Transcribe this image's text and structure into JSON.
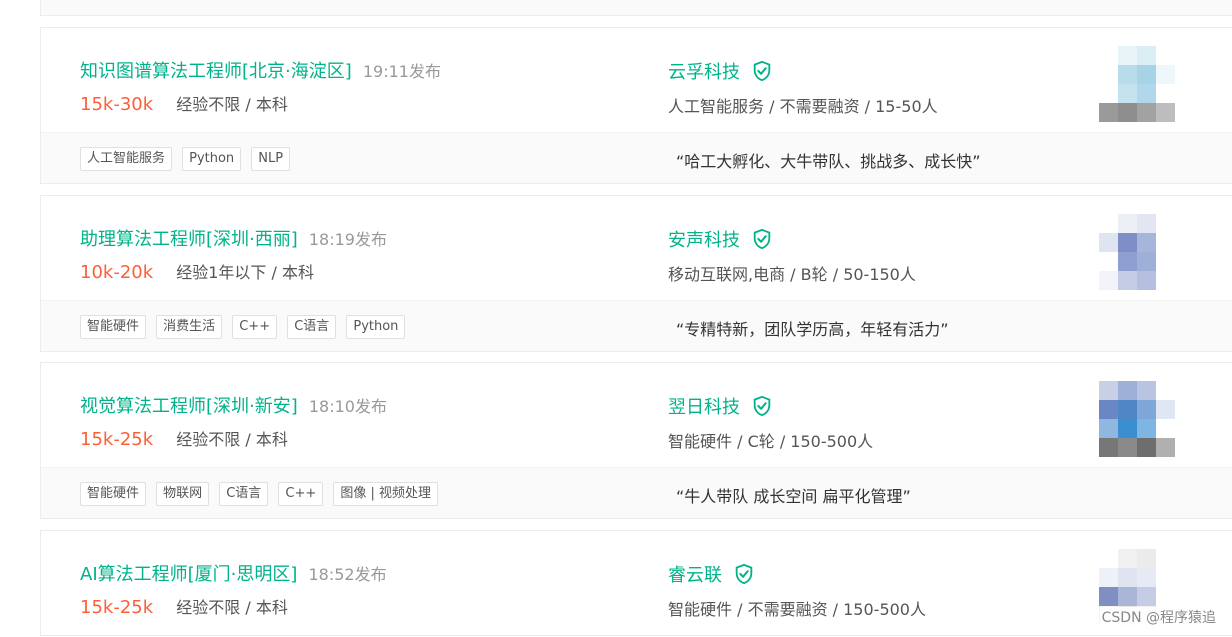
{
  "prev_card_tags": [
    "",
    "",
    "",
    ""
  ],
  "jobs": [
    {
      "title": "知识图谱算法工程师[北京·海淀区]",
      "time": "19:11发布",
      "salary": "15k-30k",
      "requirements": "经验不限 / 本科",
      "company": "云孚科技",
      "industry": "人工智能服务 / 不需要融资 / 15-50人",
      "tags": [
        "人工智能服务",
        "Python",
        "NLP"
      ],
      "slogan": "“哈工大孵化、大牛带队、挑战多、成长快”"
    },
    {
      "title": "助理算法工程师[深圳·西丽]",
      "time": "18:19发布",
      "salary": "10k-20k",
      "requirements": "经验1年以下 / 本科",
      "company": "安声科技",
      "industry": "移动互联网,电商 / B轮 / 50-150人",
      "tags": [
        "智能硬件",
        "消费生活",
        "C++",
        "C语言",
        "Python"
      ],
      "slogan": "“专精特新，团队学历高，年轻有活力”"
    },
    {
      "title": "视觉算法工程师[深圳·新安]",
      "time": "18:10发布",
      "salary": "15k-25k",
      "requirements": "经验不限 / 本科",
      "company": "翌日科技",
      "industry": "智能硬件 / C轮 / 150-500人",
      "tags": [
        "智能硬件",
        "物联网",
        "C语言",
        "C++",
        "图像 | 视频处理"
      ],
      "slogan": "“牛人带队 成长空间 扁平化管理”"
    },
    {
      "title": "AI算法工程师[厦门·思明区]",
      "time": "18:52发布",
      "salary": "15k-25k",
      "requirements": "经验不限 / 本科",
      "company": "睿云联",
      "industry": "智能硬件 / 不需要融资 / 150-500人",
      "tags": [],
      "slogan": ""
    }
  ],
  "watermark": "CSDN @程序猿追",
  "colors": {
    "accent": "#00b38a",
    "salary": "#fd5f39",
    "logos": [
      [
        "#ffffff",
        "#e8f3f8",
        "#d9eef5",
        "#ffffff",
        "#ffffff",
        "#b8dcea",
        "#a6d3e6",
        "#eef7fb",
        "#ffffff",
        "#c5e3ef",
        "#b0d8ea",
        "#ffffff",
        "#9a9a9a",
        "#8e8e8e",
        "#a2a2a2",
        "#bdbdbd"
      ],
      [
        "#ffffff",
        "#eceff6",
        "#e1e6f2",
        "#ffffff",
        "#dfe4f1",
        "#7d8fc6",
        "#a8b5da",
        "#ffffff",
        "#ffffff",
        "#8ea0cf",
        "#9fb0d8",
        "#ffffff",
        "#f2f4fa",
        "#c5cde6",
        "#b5c0e0",
        "#ffffff"
      ],
      [
        "#c8d0e6",
        "#9fb0d8",
        "#b8c4e2",
        "#ffffff",
        "#6a86c4",
        "#4f86c6",
        "#7ea6d6",
        "#dfe7f4",
        "#8fb7e0",
        "#3b8fd0",
        "#7fb5e3",
        "#ffffff",
        "#777777",
        "#8a8a8a",
        "#6e6e6e",
        "#b0b0b0"
      ],
      [
        "#ffffff",
        "#f0f0f0",
        "#ebebeb",
        "#ffffff",
        "#eef1f7",
        "#dfe4f0",
        "#e6eaf4",
        "#ffffff",
        "#7f8fc2",
        "#aab6d8",
        "#c5cde6",
        "#ffffff",
        "#f4f4f4",
        "#e9e9e9",
        "#f0f0f0",
        "#ffffff"
      ]
    ]
  }
}
